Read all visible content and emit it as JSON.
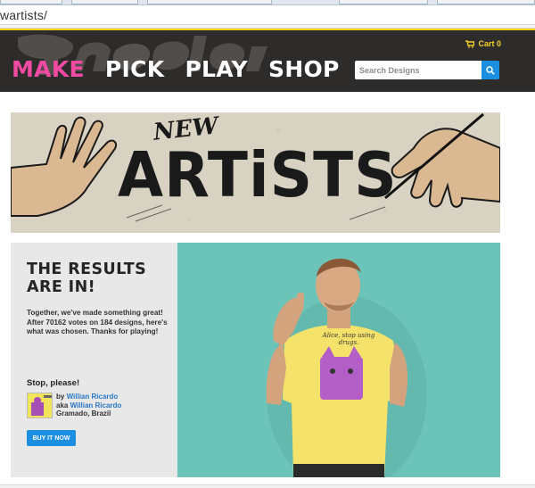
{
  "browser": {
    "url": "wartists/"
  },
  "header": {
    "nav": [
      "MAKE",
      "PICK",
      "PLAY",
      "SHOP"
    ],
    "cart_label": "Cart 0",
    "search_placeholder": "Search Designs",
    "accent_color": "#f04aa3",
    "cart_color": "#f3d22a",
    "button_color": "#1c8fe0"
  },
  "banner": {
    "badge": "NEW",
    "title": "ARTiSTS"
  },
  "results": {
    "heading": "THE RESULTS ARE IN!",
    "copy_intro": "Together, we've made something great! After ",
    "votes": "70162",
    "copy_mid": " votes on ",
    "designs": "184",
    "copy_end": " designs, here's what was chosen. Thanks for playing!",
    "design_name": "Stop, please!",
    "by_label": "by ",
    "artist_name": "Willian Ricardo",
    "aka_label": "aka ",
    "aka_name": "Willian Ricardo",
    "location": "Gramado, Brazil",
    "buy_label": "BUY IT NOW"
  },
  "photo": {
    "shirt_text": "Alice, stop using drugs."
  }
}
